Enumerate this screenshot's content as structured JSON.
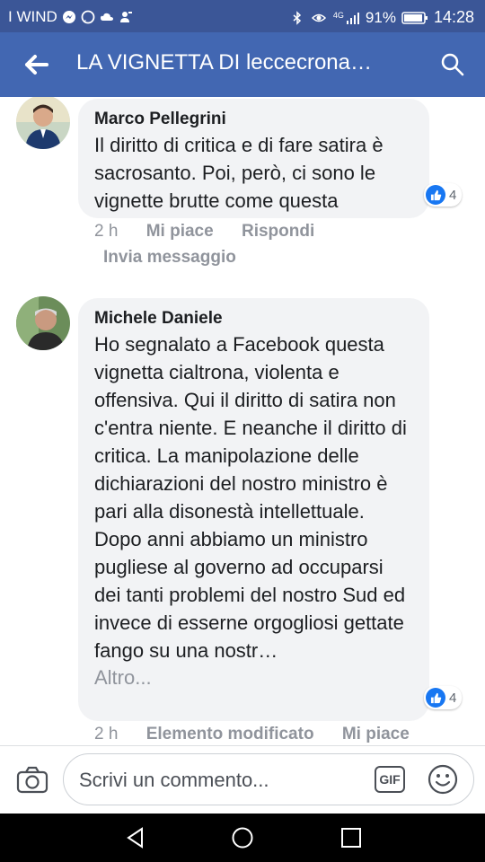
{
  "status_bar": {
    "carrier": "I WIND",
    "network": "4G",
    "battery": "91%",
    "time": "14:28",
    "icons": [
      "messenger-icon",
      "whatsapp-icon",
      "cloud-icon",
      "person-notification-icon",
      "bluetooth-icon",
      "eye-icon",
      "signal-icon",
      "battery-icon"
    ]
  },
  "header": {
    "title": "LA VIGNETTA DI leccecrona…",
    "back_icon": "arrow-left-icon",
    "search_icon": "search-icon"
  },
  "comments": [
    {
      "author": "Marco Pellegrini",
      "text": "Il diritto di critica e di fare satira è sacrosanto. Poi, però, ci sono le vignette brutte come questa",
      "reactions": "4",
      "time": "2 h",
      "like_label": "Mi piace",
      "reply_label": "Rispondi",
      "message_label": "Invia messaggio"
    },
    {
      "author": "Michele Daniele",
      "text": "Ho segnalato a Facebook questa vignetta cialtrona, violenta e offensiva. Qui il diritto di satira non c'entra niente. E neanche il diritto di critica. La manipolazione delle dichiarazioni del nostro ministro è pari alla disonestà intellettuale. Dopo anni abbiamo un ministro pugliese al governo ad occuparsi dei tanti problemi del nostro Sud ed invece di esserne orgogliosi gettate fango su una nostr…",
      "more_label": "Altro...",
      "reactions": "4",
      "time": "2 h",
      "edited_label": "Elemento modificato",
      "like_label": "Mi piace"
    }
  ],
  "composer": {
    "placeholder": "Scrivi un commento...",
    "gif_label": "GIF",
    "camera_icon": "camera-icon",
    "emoji_icon": "emoji-icon"
  },
  "colors": {
    "status_bar": "#3b5697",
    "app_bar": "#4267b2",
    "bubble": "#f2f3f5",
    "like_blue": "#1877f2",
    "meta_gray": "#90949c"
  }
}
